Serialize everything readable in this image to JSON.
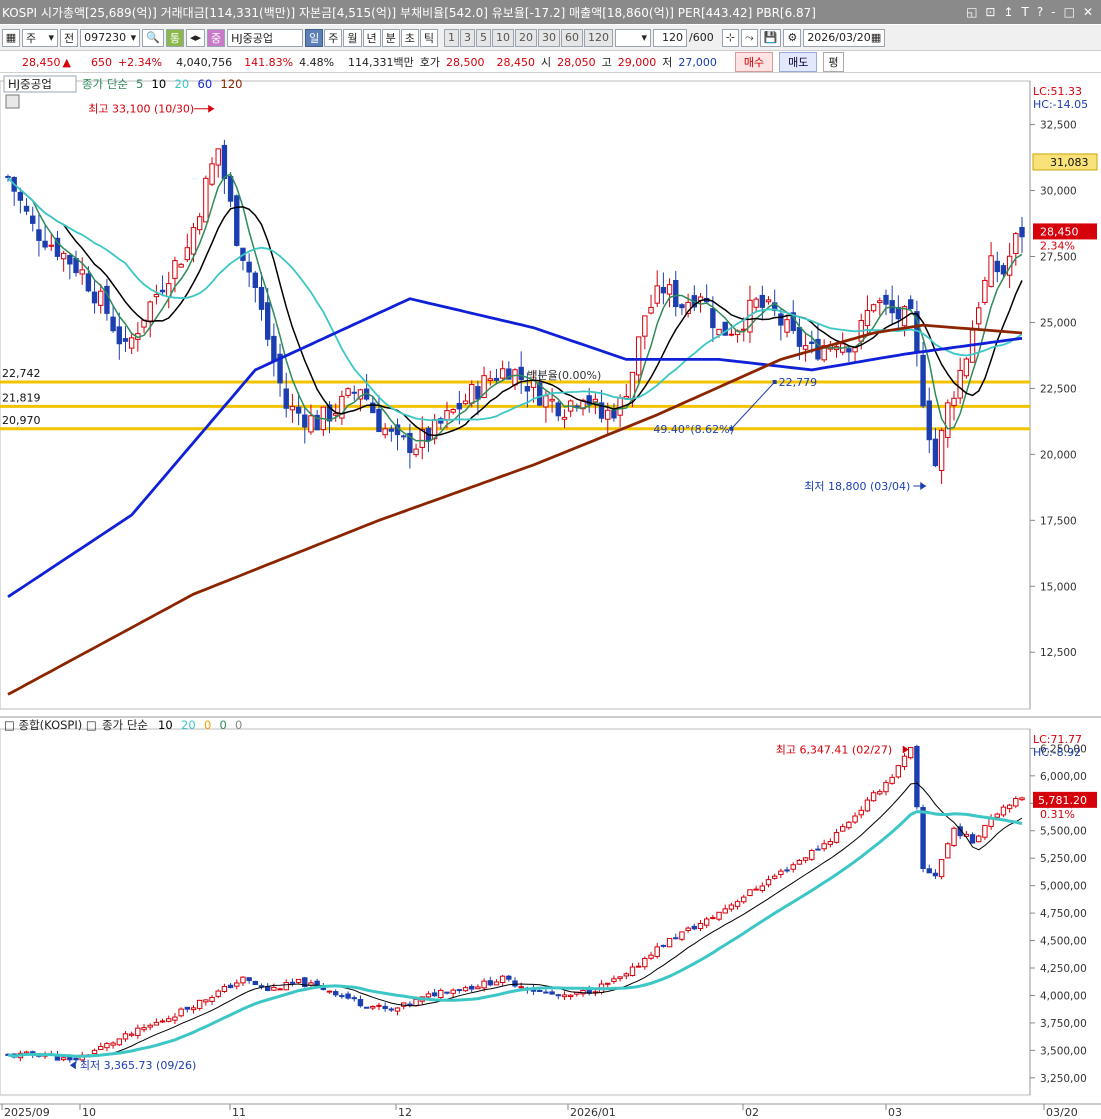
{
  "titlebar": {
    "text": "KOSPI 시가총액[25,689(억)] 거래대금[114,331(백만)] 자본금[4,515(억)] 부채비율[542.0] 유보율[-17.2] 매출액[18,860(억)] PER[443.42] PBR[6.87]",
    "controls": [
      "◱",
      "⊡",
      "↥",
      "T",
      "?",
      "-",
      "□",
      "✕"
    ]
  },
  "toolbar": {
    "period_type": "주",
    "prev_label": "전",
    "code": "097230",
    "tong": "통",
    "jung": "중",
    "stock_name": "HJ중공업",
    "timeframes": [
      "일",
      "주",
      "월",
      "년",
      "분",
      "초",
      "틱"
    ],
    "intervals": [
      "1",
      "3",
      "5",
      "10",
      "20",
      "30",
      "60",
      "120"
    ],
    "count": "120",
    "count_total": "/600",
    "date": "2026/03/20"
  },
  "pricebar": {
    "price": "28,450",
    "change": "650",
    "change_pct": "+2.34%",
    "volume": "4,040,756",
    "volume_ratio": "141.83%",
    "turnover": "4.48%",
    "amount": "114,331백만",
    "hoga_label": "호가",
    "ask": "28,500",
    "bid": "28,450",
    "open_label": "시",
    "open": "28,050",
    "high_label": "고",
    "high": "29,000",
    "low_label": "저",
    "low": "27,000",
    "buy": "매수",
    "sell": "매도",
    "flat": "평"
  },
  "colors": {
    "up": "#d6000b",
    "down": "#1c3fb0",
    "ma5": "#2e8b57",
    "ma10": "#000000",
    "ma20": "#3cc6c6",
    "ma60": "#1020d8",
    "ma120": "#8b2500",
    "support": "#f2c300"
  },
  "chart_data": [
    {
      "type": "candlestick",
      "name": "HJ중공업",
      "legend": {
        "prefix": "종가 단순",
        "periods": [
          "5",
          "10",
          "20",
          "60",
          "120"
        ]
      },
      "y_ticks": [
        "32,500",
        "30,000",
        "27,500",
        "25,000",
        "22,500",
        "20,000",
        "17,500",
        "15,000",
        "12,500"
      ],
      "ylim": [
        10500,
        34000
      ],
      "lc": "LC:51.33",
      "hc": "HC:-14.05",
      "marker_price": "31,083",
      "last_price": "28,450",
      "last_change": "2.34%",
      "high_annotation": "최고 33,100 (10/30)",
      "low_annotation": "최저 18,800 (03/04)",
      "support_levels": [
        {
          "value": 22742,
          "label": "22,742"
        },
        {
          "value": 21819,
          "label": "21,819"
        },
        {
          "value": 20970,
          "label": "20,970"
        }
      ],
      "fib_label": "49.40°(8.62%)",
      "fib_end_label": "22,779",
      "fib_top_label": "백분율(0.00%)",
      "ohlc_anchors": [
        [
          0,
          30500
        ],
        [
          4,
          28600
        ],
        [
          8,
          27800
        ],
        [
          12,
          26900
        ],
        [
          16,
          25400
        ],
        [
          19,
          23900
        ],
        [
          22,
          25300
        ],
        [
          26,
          26900
        ],
        [
          29,
          27800
        ],
        [
          32,
          30200
        ],
        [
          34,
          31600
        ],
        [
          37,
          28300
        ],
        [
          40,
          26300
        ],
        [
          42,
          24400
        ],
        [
          45,
          21800
        ],
        [
          50,
          21200
        ],
        [
          54,
          21900
        ],
        [
          57,
          22600
        ],
        [
          60,
          21200
        ],
        [
          63,
          20400
        ],
        [
          66,
          20400
        ],
        [
          69,
          20900
        ],
        [
          72,
          21600
        ],
        [
          75,
          22300
        ],
        [
          78,
          22900
        ],
        [
          81,
          23300
        ],
        [
          84,
          22700
        ],
        [
          87,
          22100
        ],
        [
          90,
          21800
        ],
        [
          93,
          22400
        ],
        [
          96,
          21400
        ],
        [
          99,
          21900
        ],
        [
          101,
          23200
        ],
        [
          103,
          25300
        ],
        [
          106,
          26300
        ],
        [
          109,
          25700
        ],
        [
          112,
          26200
        ],
        [
          115,
          24600
        ],
        [
          118,
          24900
        ],
        [
          121,
          25700
        ],
        [
          124,
          25300
        ],
        [
          127,
          24400
        ],
        [
          130,
          23900
        ],
        [
          134,
          24400
        ],
        [
          137,
          24200
        ],
        [
          140,
          25900
        ],
        [
          143,
          25300
        ],
        [
          146,
          25100
        ],
        [
          148,
          22200
        ],
        [
          150,
          19600
        ],
        [
          152,
          21800
        ],
        [
          155,
          23800
        ],
        [
          157,
          25800
        ],
        [
          159,
          27100
        ],
        [
          161,
          26900
        ],
        [
          163,
          28100
        ],
        [
          164,
          28450
        ]
      ],
      "ma60_points": [
        [
          0,
          14600
        ],
        [
          20,
          17700
        ],
        [
          40,
          23200
        ],
        [
          65,
          25900
        ],
        [
          85,
          24800
        ],
        [
          100,
          23600
        ],
        [
          115,
          23600
        ],
        [
          130,
          23200
        ],
        [
          145,
          23800
        ],
        [
          164,
          24400
        ]
      ],
      "ma120_points": [
        [
          0,
          10900
        ],
        [
          30,
          14700
        ],
        [
          60,
          17500
        ],
        [
          85,
          19600
        ],
        [
          105,
          21500
        ],
        [
          125,
          23600
        ],
        [
          140,
          24600
        ],
        [
          148,
          24900
        ],
        [
          164,
          24600
        ]
      ]
    },
    {
      "type": "candlestick",
      "name": "종합(KOSPI)",
      "legend": {
        "prefix": "종가 단순",
        "periods": [
          "10",
          "20",
          "0",
          "0",
          "0"
        ]
      },
      "y_ticks": [
        "6,250,00",
        "6,000,00",
        "5,750,00",
        "5,500,00",
        "5,250,00",
        "5,000,00",
        "4,750,00",
        "4,500,00",
        "4,250,00",
        "4,000,00",
        "3,750,00",
        "3,500,00",
        "3,250,00"
      ],
      "ylim": [
        3130,
        6390
      ],
      "lc": "LC:71.77",
      "hc": "HC:-8.92",
      "last_price": "5,781.20",
      "last_change": "0.31%",
      "high_annotation": "최고 6,347.41 (02/27)",
      "low_annotation": "최저 3,365.73 (09/26)",
      "ohlc_anchors": [
        [
          0,
          3450
        ],
        [
          6,
          3470
        ],
        [
          10,
          3400
        ],
        [
          14,
          3500
        ],
        [
          20,
          3650
        ],
        [
          26,
          3800
        ],
        [
          33,
          4000
        ],
        [
          38,
          4150
        ],
        [
          42,
          4050
        ],
        [
          47,
          4120
        ],
        [
          52,
          4050
        ],
        [
          57,
          3930
        ],
        [
          62,
          3860
        ],
        [
          66,
          3950
        ],
        [
          70,
          4040
        ],
        [
          75,
          4080
        ],
        [
          80,
          4150
        ],
        [
          85,
          4050
        ],
        [
          90,
          3980
        ],
        [
          95,
          4060
        ],
        [
          100,
          4180
        ],
        [
          104,
          4390
        ],
        [
          108,
          4540
        ],
        [
          113,
          4680
        ],
        [
          118,
          4870
        ],
        [
          123,
          5050
        ],
        [
          128,
          5230
        ],
        [
          133,
          5420
        ],
        [
          138,
          5700
        ],
        [
          143,
          6000
        ],
        [
          146,
          6240
        ],
        [
          148,
          5150
        ],
        [
          150,
          5100
        ],
        [
          153,
          5520
        ],
        [
          156,
          5400
        ],
        [
          159,
          5630
        ],
        [
          162,
          5760
        ],
        [
          164,
          5781
        ]
      ],
      "x_labels": [
        "2025/09",
        "10",
        "11",
        "12",
        "2026/01",
        "02",
        "03",
        "03/20"
      ]
    }
  ]
}
